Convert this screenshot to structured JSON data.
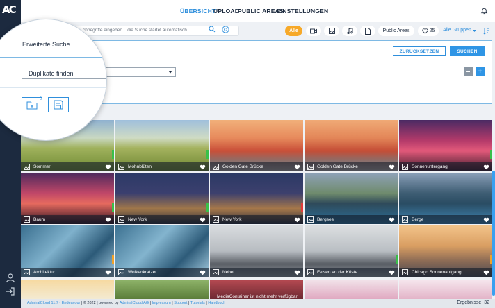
{
  "sidebar": {
    "logo": "AC"
  },
  "nav": {
    "items": [
      {
        "label": "ÜBERSICHT",
        "active": true
      },
      {
        "label": "UPLOAD",
        "active": false
      },
      {
        "label": "PUBLIC AREAS",
        "active": false
      },
      {
        "label": "EINSTELLUNGEN",
        "active": false
      }
    ]
  },
  "filter": {
    "search_placeholder": "chbegriffe eingeben... die Suche startet automatisch.",
    "all_label": "Alle",
    "public_areas_label": "Public Areas",
    "favorites_count": "25",
    "groups_label": "Alle Gruppen"
  },
  "advanced": {
    "title": "Erweiterte Suche",
    "select_value": "Duplikate finden",
    "reset_label": "ZURÜCKSETZEN",
    "search_label": "SUCHEN",
    "minus_label": "–",
    "plus_label": "+",
    "badge": "0"
  },
  "tiles": [
    {
      "title": "Sommer",
      "stripe": "#39c04a"
    },
    {
      "title": "Mohnblüten",
      "stripe": "#39c04a"
    },
    {
      "title": "Golden Gate Brücke",
      "stripe": ""
    },
    {
      "title": "Golden Gate Brücke",
      "stripe": ""
    },
    {
      "title": "Sonnenuntergang",
      "stripe": "#39c04a"
    },
    {
      "title": "Baum",
      "stripe": "#39c04a"
    },
    {
      "title": "New York",
      "stripe": "#39c04a"
    },
    {
      "title": "New York",
      "stripe": "#e23a3a"
    },
    {
      "title": "Bergsee",
      "stripe": ""
    },
    {
      "title": "Berge",
      "stripe": ""
    },
    {
      "title": "Architektur",
      "stripe": "#f0a22a"
    },
    {
      "title": "Wolkenkratzer",
      "stripe": ""
    },
    {
      "title": "Nebel",
      "stripe": ""
    },
    {
      "title": "Felsen an der Küste",
      "stripe": "#39c04a"
    },
    {
      "title": "Chicago Sonnenaufgang",
      "stripe": "#f0a22a"
    }
  ],
  "overlay_text": "MediaContainer ist nicht mehr verfügbar",
  "footer": {
    "product": "AdmiralCloud 11.7 - Endeavour",
    "copyright": "© 2022",
    "powered": "powered by",
    "company": "AdmiralCloud AG",
    "impressum": "Impressum",
    "support": "Support",
    "tutorials": "Tutorials",
    "handbuch": "Handbuch",
    "results": "Ergebnisse: 32"
  },
  "colors": {
    "accent": "#2f8fdc",
    "orange": "#f7a928",
    "sidebar": "#1c2a3f"
  }
}
